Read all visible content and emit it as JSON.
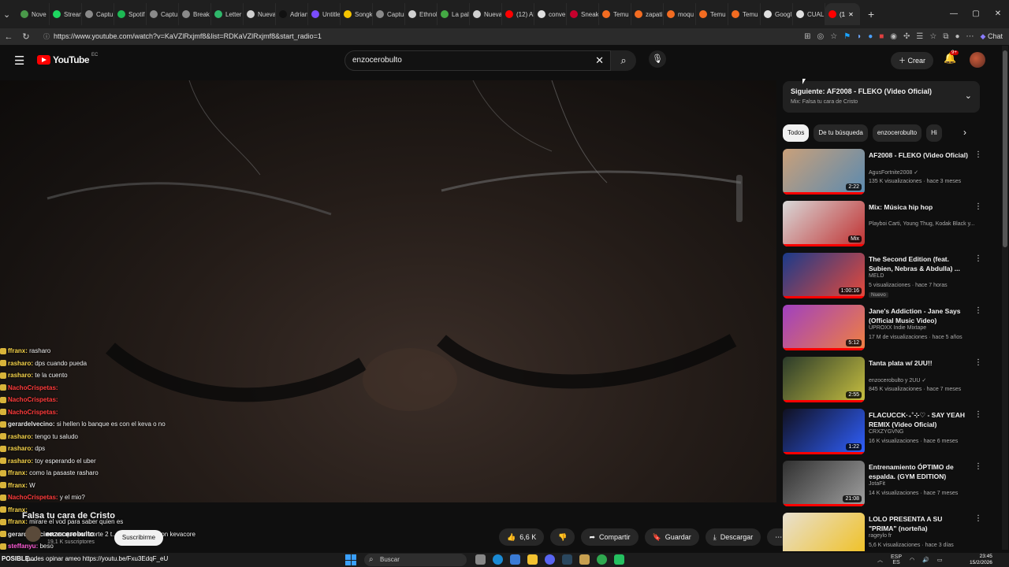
{
  "browser": {
    "tabs": [
      {
        "label": "Nove",
        "color": "#4a9a4a"
      },
      {
        "label": "Stream",
        "color": "#1ed760"
      },
      {
        "label": "Captu",
        "color": "#8a8a8a"
      },
      {
        "label": "Spotif",
        "color": "#1db954"
      },
      {
        "label": "Captu",
        "color": "#8a8a8a"
      },
      {
        "label": "Break",
        "color": "#8a8a8a"
      },
      {
        "label": "Letter",
        "color": "#2fb86b"
      },
      {
        "label": "Nueva",
        "color": "#d0d0d0"
      },
      {
        "label": "Adrian",
        "color": "#111111"
      },
      {
        "label": "Untitle",
        "color": "#7a4cff"
      },
      {
        "label": "Songk",
        "color": "#f5c400"
      },
      {
        "label": "Captur",
        "color": "#8a8a8a"
      },
      {
        "label": "Ethnol",
        "color": "#d0d0d0"
      },
      {
        "label": "La pal",
        "color": "#44aa44"
      },
      {
        "label": "Nueva",
        "color": "#d0d0d0"
      },
      {
        "label": "(12) Al",
        "color": "#ff0000"
      },
      {
        "label": "conve",
        "color": "#e0e0e0"
      },
      {
        "label": "Sneak",
        "color": "#c7002d"
      },
      {
        "label": "Temu",
        "color": "#f36c21"
      },
      {
        "label": "zapati",
        "color": "#f36c21"
      },
      {
        "label": "moqu",
        "color": "#f36c21"
      },
      {
        "label": "Temu",
        "color": "#f36c21"
      },
      {
        "label": "Temu",
        "color": "#f36c21"
      },
      {
        "label": "Googl",
        "color": "#e0e0e0"
      },
      {
        "label": "CUAL",
        "color": "#e0e0e0"
      },
      {
        "label": "(1",
        "color": "#ff0000",
        "active": true
      }
    ],
    "url": "https://www.youtube.com/watch?v=KaVZlRxjmf8&list=RDKaVZlRxjmf8&start_radio=1",
    "chat_label": "Chat"
  },
  "youtube": {
    "logo_text": "YouTube",
    "country_code": "EC",
    "search_value": "enzocerobulto",
    "create_label": "Crear",
    "notif_badge": "9+"
  },
  "chat_overlay": [
    {
      "user": "ffranx:",
      "msg": "rasharo",
      "color": "#f5d34a"
    },
    {
      "user": "rasharo:",
      "msg": "dps cuando pueda",
      "color": "#f5d34a"
    },
    {
      "user": "rasharo:",
      "msg": "te la cuento",
      "color": "#f5d34a"
    },
    {
      "user": "NachoCrispetas:",
      "msg": "",
      "color": "#ff3b3b"
    },
    {
      "user": "NachoCrispetas:",
      "msg": "",
      "color": "#ff3b3b"
    },
    {
      "user": "NachoCrispetas:",
      "msg": "",
      "color": "#ff3b3b"
    },
    {
      "user": "gerardelvecino:",
      "msg": "si hellen lo banque es con el keva o no",
      "color": "#e5e5e5"
    },
    {
      "user": "rasharo:",
      "msg": "tengo tu saludo",
      "color": "#f5d34a"
    },
    {
      "user": "rasharo:",
      "msg": "dps",
      "color": "#f5d34a"
    },
    {
      "user": "rasharo:",
      "msg": "toy esperando el uber",
      "color": "#f5d34a"
    },
    {
      "user": "ffranx:",
      "msg": "como la pasaste rasharo",
      "color": "#f5d34a"
    },
    {
      "user": "ffranx:",
      "msg": "W",
      "color": "#f5d34a"
    },
    {
      "user": "NachoCrispetas:",
      "msg": "y el mio?",
      "color": "#ff3b3b"
    },
    {
      "user": "ffranx:",
      "msg": "",
      "color": "#f5d34a"
    },
    {
      "user": "ffranx:",
      "msg": "mirare el vod para saber quien es",
      "color": "#f5d34a"
    },
    {
      "user": "gerardelvecino:",
      "msg": "es que son corte 2 t... loco y uno es con kevacore",
      "color": "#e5e5e5"
    },
    {
      "user": "steffanyu:",
      "msg": "beso",
      "color": "#ff5cd8"
    }
  ],
  "video": {
    "title": "Falsa tu cara de Cristo",
    "channel": "enzocerobulto",
    "subscribers": "19,1 K suscriptores",
    "subscribe_label": "Suscribirme",
    "like_count": "6,6 K",
    "share_label": "Compartir",
    "save_label": "Guardar",
    "download_label": "Descargar"
  },
  "up_next": {
    "title": "Siguiente: AF2008 - FLEKO (Video Oficial)",
    "subtitle": "Mix: Falsa tu cara de Cristo"
  },
  "chips": [
    {
      "label": "Todos",
      "active": true
    },
    {
      "label": "De tu búsqueda"
    },
    {
      "label": "enzocerobulto"
    },
    {
      "label": "Hi"
    }
  ],
  "recommendations": [
    {
      "title": "AF2008 - FLEKO (Video Oficial)",
      "channel": "AgusFortnite2008 ✓",
      "meta": "135 K visualizaciones · hace 3 meses",
      "duration": "2:22",
      "colors": [
        "#c9a07a",
        "#5a8ab0"
      ]
    },
    {
      "title": "Mix: Música hip hop",
      "channel": "Playboi Carti, Young Thug, Kodak Black y...",
      "meta": "",
      "duration": "Mix",
      "colors": [
        "#d8d8d8",
        "#c03030"
      ]
    },
    {
      "title": "The Second Edition (feat. Subien, Nebras & Abdulla) ...",
      "channel": "MELD",
      "meta": "5 visualizaciones · hace 7 horas",
      "duration": "1:00:16",
      "new": "Nuevo",
      "colors": [
        "#1a3a8a",
        "#e84a3a"
      ]
    },
    {
      "title": "Jane's Addiction - Jane Says (Official Music Video)",
      "channel": "UPROXX Indie Mixtape",
      "meta": "17 M de visualizaciones · hace 5 años",
      "duration": "5:12",
      "colors": [
        "#a040c0",
        "#f08040"
      ]
    },
    {
      "title": "Tanta plata w/ 2UU!!",
      "channel": "enzocerobulto y 2UU ✓",
      "meta": "845 K visualizaciones · hace 7 meses",
      "duration": "2:55",
      "colors": [
        "#2a3a2a",
        "#c8c040"
      ]
    },
    {
      "title": "FLACUCCK·₊˚⊹♡ - SAY YEAH REMIX (Video Oficial)",
      "channel": "CRXZYGVNG",
      "meta": "16 K visualizaciones · hace 6 meses",
      "duration": "1:22",
      "colors": [
        "#101020",
        "#3060ff"
      ]
    },
    {
      "title": "Entrenamiento ÓPTIMO de espalda. (GYM EDITION)",
      "channel": "JotaFit",
      "meta": "14 K visualizaciones · hace 7 meses",
      "duration": "21:08",
      "colors": [
        "#303030",
        "#a0a0a0"
      ]
    },
    {
      "title": "LOLO PRESENTA A SU \"PRIMA\" (norteña)",
      "channel": "rageylo fr",
      "meta": "5,6 K visualizaciones · hace 3 días",
      "duration": "",
      "colors": [
        "#e8e0d0",
        "#f0c020"
      ]
    }
  ],
  "taskbar": {
    "weather": "POSIBLE...",
    "status_overlay": "podes opinar ameo https://youtu.be/Fxu3EdqF_eU",
    "search_label": "Buscar",
    "lang": "ESP",
    "region": "ES",
    "time": "23:45",
    "date": "15/2/2026"
  }
}
